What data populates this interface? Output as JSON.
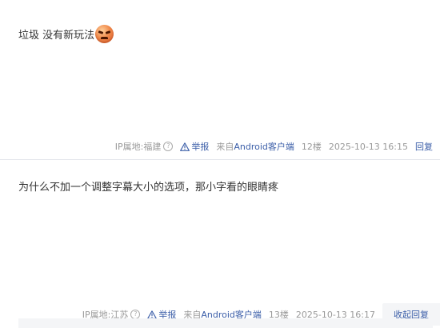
{
  "posts": [
    {
      "content": "垃圾 没有新玩法",
      "emoji": "angry-face-emoji",
      "ip_location": "IP属地:福建",
      "report_label": "举报",
      "client_prefix": "来自",
      "client_name": "Android客户端",
      "floor": "12楼",
      "timestamp": "2025-10-13 16:15",
      "reply_label": "回复"
    },
    {
      "content": "为什么不加一个调整字幕大小的选项，那小字看的眼睛疼",
      "ip_location": "IP属地:江苏",
      "report_label": "举报",
      "client_prefix": "来自",
      "client_name": "Android客户端",
      "floor": "13楼",
      "timestamp": "2025-10-13 16:17",
      "reply_label": "收起回复"
    }
  ],
  "colors": {
    "link": "#3b5ea8",
    "meta_text": "#999999",
    "content_text": "#333333",
    "reply_panel_bg": "#f4f5f7"
  }
}
